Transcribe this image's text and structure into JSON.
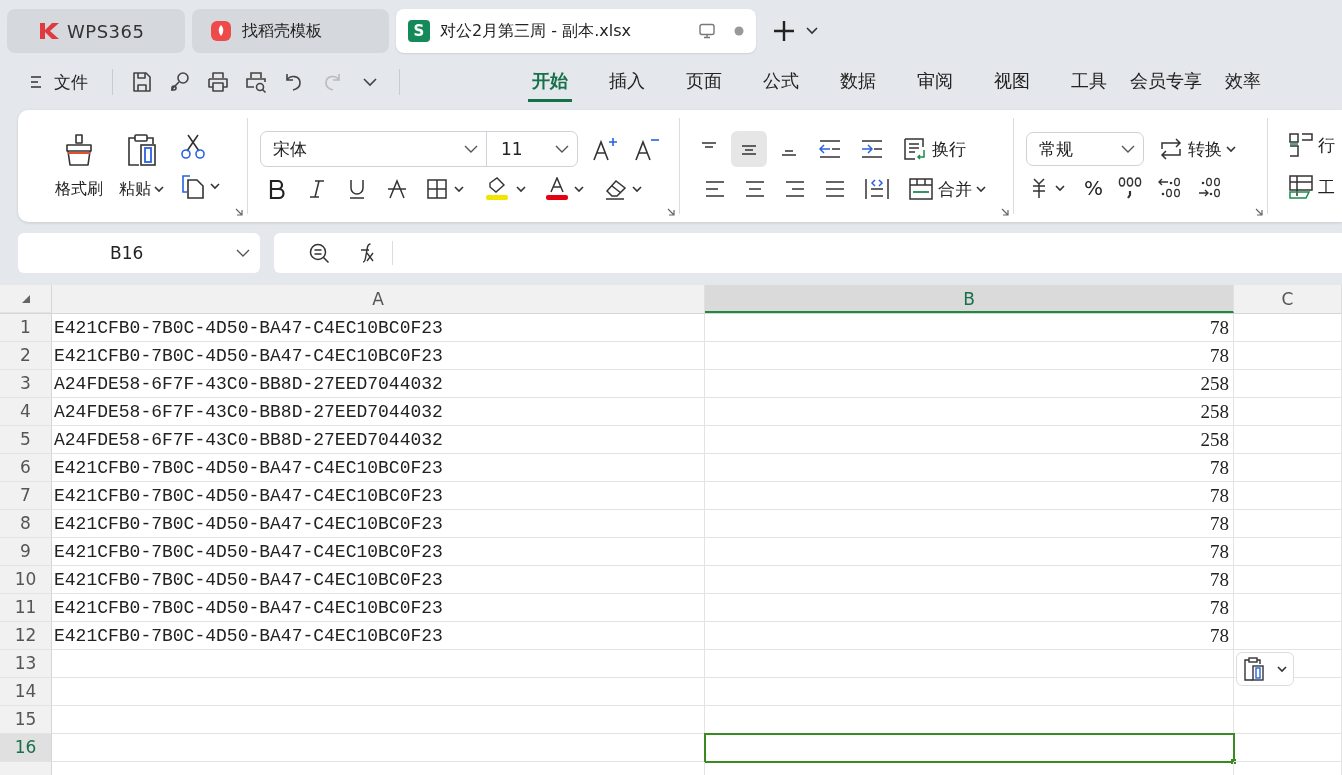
{
  "tabs": [
    {
      "kind": "app",
      "label": "WPS365",
      "selected": false
    },
    {
      "kind": "template",
      "label": "找稻壳模板",
      "selected": false
    },
    {
      "kind": "sheet",
      "badge": "S",
      "label": "对公2月第三周 - 副本.xlsx",
      "selected": true
    }
  ],
  "menu": {
    "file": "文件",
    "ribbon_tabs": [
      {
        "label": "开始",
        "selected": true
      },
      {
        "label": "插入",
        "selected": false
      },
      {
        "label": "页面",
        "selected": false
      },
      {
        "label": "公式",
        "selected": false
      },
      {
        "label": "数据",
        "selected": false
      },
      {
        "label": "审阅",
        "selected": false
      },
      {
        "label": "视图",
        "selected": false
      },
      {
        "label": "工具",
        "selected": false
      },
      {
        "label": "会员专享",
        "selected": false
      },
      {
        "label": "效率",
        "selected": false
      }
    ]
  },
  "ribbon": {
    "format_painter": "格式刷",
    "paste": "粘贴",
    "font": "宋体",
    "size": "11",
    "vertical_align": [
      {
        "selected": false
      },
      {
        "selected": true
      },
      {
        "selected": false
      }
    ],
    "wrap": "换行",
    "merge": "合并",
    "number_format": "常规",
    "convert": "转换",
    "percent": "%",
    "rows_cols": "行",
    "worksheet": "工"
  },
  "formula_bar": {
    "cell": "B16"
  },
  "sheet": {
    "columns": [
      {
        "label": "A",
        "selected": false
      },
      {
        "label": "B",
        "selected": true
      },
      {
        "label": "C",
        "selected": false
      }
    ],
    "rows": [
      {
        "number": "1",
        "selected": false,
        "a": "E421CFB0-7B0C-4D50-BA47-C4EC10BC0F23",
        "b": "78"
      },
      {
        "number": "2",
        "selected": false,
        "a": "E421CFB0-7B0C-4D50-BA47-C4EC10BC0F23",
        "b": "78"
      },
      {
        "number": "3",
        "selected": false,
        "a": "A24FDE58-6F7F-43C0-BB8D-27EED7044032",
        "b": "258"
      },
      {
        "number": "4",
        "selected": false,
        "a": "A24FDE58-6F7F-43C0-BB8D-27EED7044032",
        "b": "258"
      },
      {
        "number": "5",
        "selected": false,
        "a": "A24FDE58-6F7F-43C0-BB8D-27EED7044032",
        "b": "258"
      },
      {
        "number": "6",
        "selected": false,
        "a": "E421CFB0-7B0C-4D50-BA47-C4EC10BC0F23",
        "b": "78"
      },
      {
        "number": "7",
        "selected": false,
        "a": "E421CFB0-7B0C-4D50-BA47-C4EC10BC0F23",
        "b": "78"
      },
      {
        "number": "8",
        "selected": false,
        "a": "E421CFB0-7B0C-4D50-BA47-C4EC10BC0F23",
        "b": "78"
      },
      {
        "number": "9",
        "selected": false,
        "a": "E421CFB0-7B0C-4D50-BA47-C4EC10BC0F23",
        "b": "78"
      },
      {
        "number": "10",
        "selected": false,
        "a": "E421CFB0-7B0C-4D50-BA47-C4EC10BC0F23",
        "b": "78"
      },
      {
        "number": "11",
        "selected": false,
        "a": "E421CFB0-7B0C-4D50-BA47-C4EC10BC0F23",
        "b": "78"
      },
      {
        "number": "12",
        "selected": false,
        "a": "E421CFB0-7B0C-4D50-BA47-C4EC10BC0F23",
        "b": "78"
      },
      {
        "number": "13",
        "selected": false
      },
      {
        "number": "14",
        "selected": false
      },
      {
        "number": "15",
        "selected": false
      },
      {
        "number": "16",
        "selected": true
      }
    ]
  }
}
